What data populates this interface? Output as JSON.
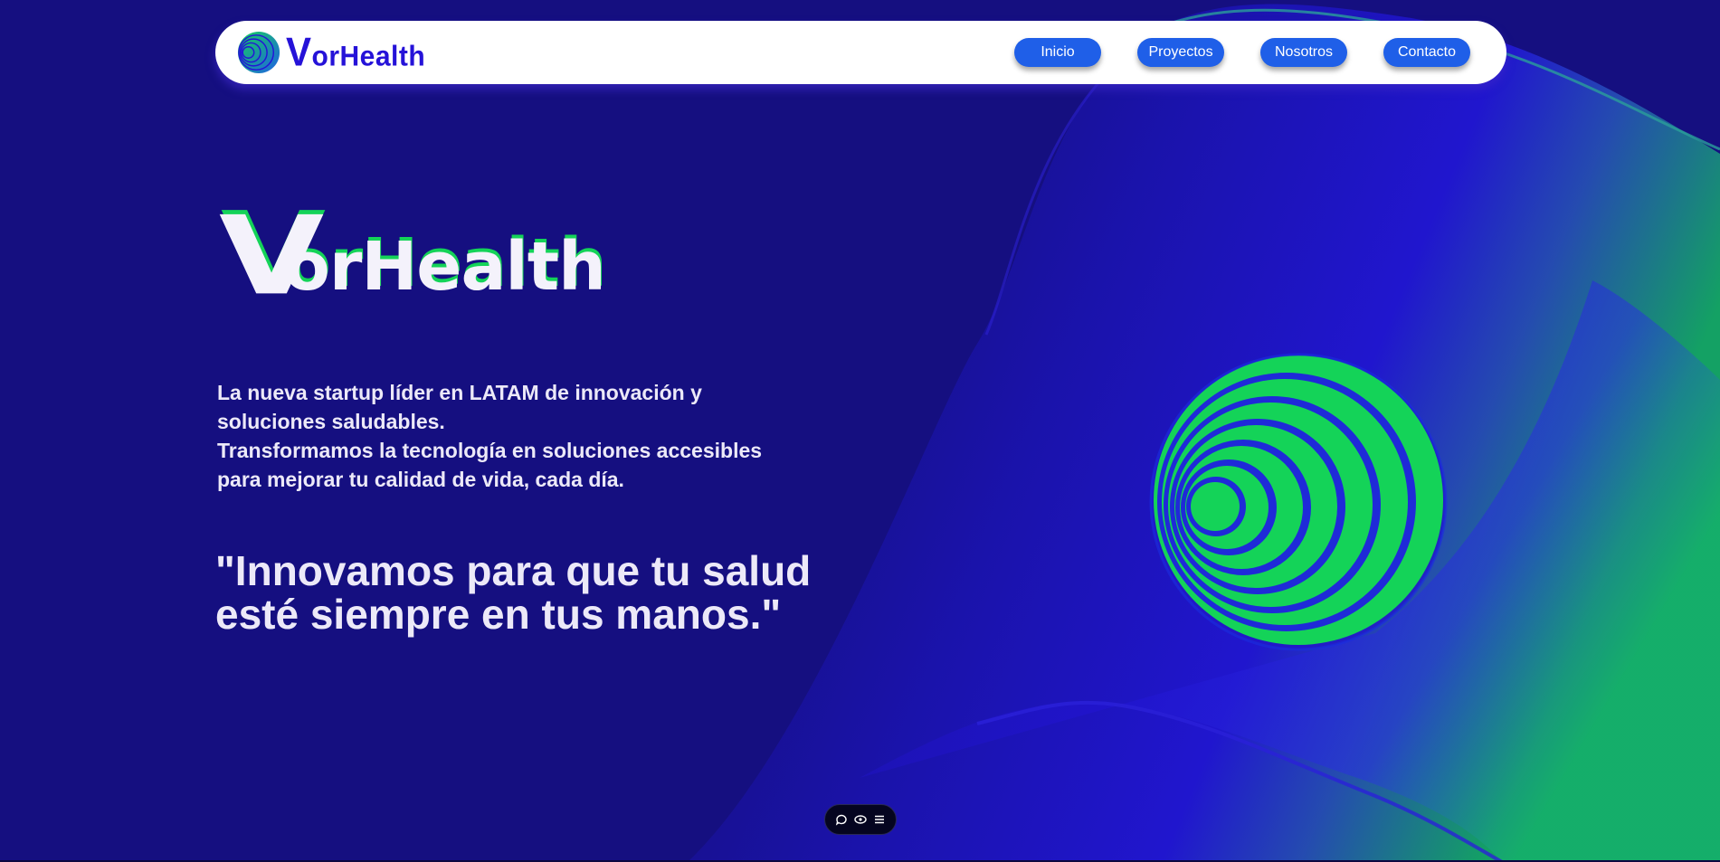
{
  "brand": {
    "name": "VorHealth",
    "initial": "V",
    "rest": "orHealth"
  },
  "nav": {
    "items": [
      {
        "label": "Inicio"
      },
      {
        "label": "Proyectos"
      },
      {
        "label": "Nosotros"
      },
      {
        "label": "Contacto"
      }
    ]
  },
  "hero": {
    "description_lines": [
      "La nueva startup líder en LATAM de innovación y soluciones saludables.",
      "Transformamos la tecnología en soluciones accesibles para mejorar tu calidad de vida, cada día."
    ],
    "quote": "\"Innovamos para que tu salud esté siempre en tus manos.\""
  },
  "toolbar": {
    "icons": [
      "chat-icon",
      "eye-icon",
      "menu-icon"
    ]
  },
  "colors": {
    "background": "#150f80",
    "accent_blue": "#1f5fe8",
    "brand_blue": "#2512d8",
    "brand_green": "#14d358",
    "text_light": "#ece9f8"
  }
}
